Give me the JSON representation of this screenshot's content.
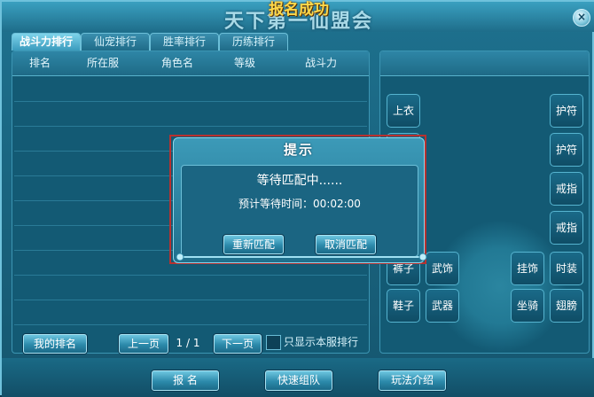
{
  "window": {
    "title": "天下第一仙盟会",
    "success_banner": "报名成功",
    "close_label": "×"
  },
  "tabs": [
    {
      "label": "战斗力排行",
      "active": true
    },
    {
      "label": "仙宠排行",
      "active": false
    },
    {
      "label": "胜率排行",
      "active": false
    },
    {
      "label": "历练排行",
      "active": false
    }
  ],
  "ranking_table": {
    "columns": [
      "排名",
      "所在服",
      "角色名",
      "等级",
      "战斗力"
    ],
    "rows": []
  },
  "pagination": {
    "my_rank_label": "我的排名",
    "prev_label": "上一页",
    "page_indicator": "1 / 1",
    "next_label": "下一页",
    "only_this_server_label": "只显示本服排行",
    "only_this_server_checked": false
  },
  "equipment_slots": {
    "left": [
      "上衣"
    ],
    "right": [
      "护符",
      "护符",
      "戒指",
      "戒指",
      "时装",
      "翅膀"
    ],
    "row_a": [
      "裤子",
      "武饰",
      "挂饰"
    ],
    "row_b": [
      "鞋子",
      "武器",
      "坐骑"
    ]
  },
  "bottom_buttons": {
    "signup_label": "报   名",
    "quick_team_label": "快速组队",
    "guide_label": "玩法介绍"
  },
  "dialog": {
    "title": "提示",
    "status": "等待匹配中......",
    "eta_label": "预计等待时间：",
    "eta_value": "00:02:00",
    "rematch_label": "重新匹配",
    "cancel_label": "取消匹配"
  }
}
